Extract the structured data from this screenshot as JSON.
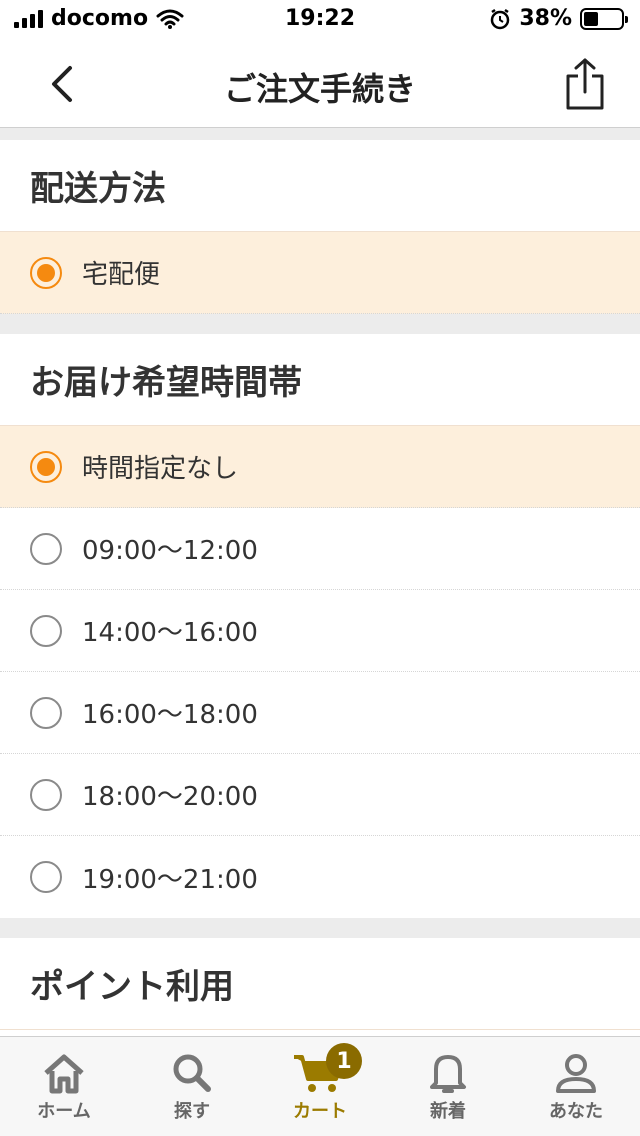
{
  "status_bar": {
    "carrier": "docomo",
    "time": "19:22",
    "battery": "38%",
    "battery_level": 0.38
  },
  "nav": {
    "title": "ご注文手続き",
    "back_icon": "chevron-left-icon",
    "share_icon": "share-icon"
  },
  "shipping": {
    "title": "配送方法",
    "options": [
      {
        "label": "宅配便",
        "selected": true
      }
    ]
  },
  "delivery_time": {
    "title": "お届け希望時間帯",
    "options": [
      {
        "label": "時間指定なし",
        "selected": true
      },
      {
        "label": "09:00〜12:00",
        "selected": false
      },
      {
        "label": "14:00〜16:00",
        "selected": false
      },
      {
        "label": "16:00〜18:00",
        "selected": false
      },
      {
        "label": "18:00〜20:00",
        "selected": false
      },
      {
        "label": "19:00〜21:00",
        "selected": false
      }
    ]
  },
  "points": {
    "title": "ポイント利用"
  },
  "tab_bar": {
    "items": [
      {
        "label": "ホーム",
        "icon": "home-icon"
      },
      {
        "label": "探す",
        "icon": "search-icon"
      },
      {
        "label": "カート",
        "icon": "cart-icon",
        "badge": "1"
      },
      {
        "label": "新着",
        "icon": "bell-icon"
      },
      {
        "label": "あなた",
        "icon": "person-icon"
      }
    ]
  },
  "colors": {
    "accent": "#f58a10",
    "selected_bg": "#fdefdc",
    "active_tab": "#9b7b00"
  }
}
